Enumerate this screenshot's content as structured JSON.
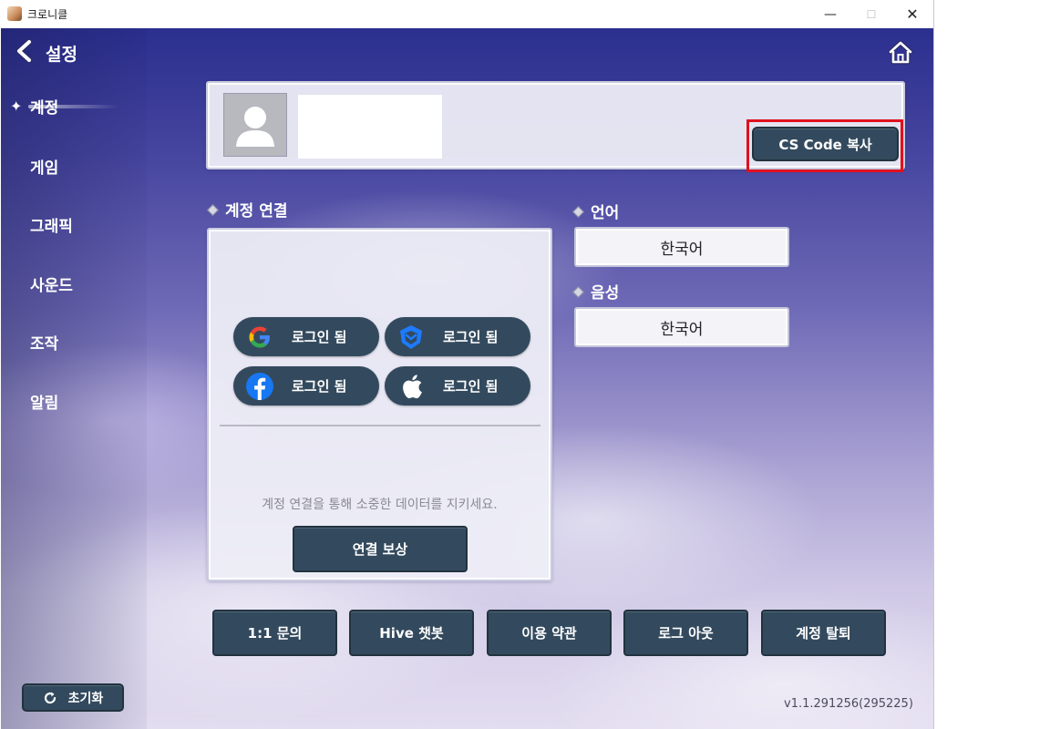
{
  "window": {
    "title": "크로니클",
    "minimize": "—",
    "maximize": "☐",
    "close": "✕"
  },
  "header": {
    "title": "설정"
  },
  "sidebar": {
    "items": [
      {
        "label": "계정",
        "active": true
      },
      {
        "label": "게임"
      },
      {
        "label": "그래픽"
      },
      {
        "label": "사운드"
      },
      {
        "label": "조작"
      },
      {
        "label": "알림"
      }
    ]
  },
  "profile": {
    "cs_button": "CS Code 복사"
  },
  "account_link": {
    "title": "계정 연결",
    "logins": [
      {
        "provider_icon": "google-icon",
        "label": "로그인 됨"
      },
      {
        "provider_icon": "hive-icon",
        "label": "로그인 됨"
      },
      {
        "provider_icon": "facebook-icon",
        "label": "로그인 됨"
      },
      {
        "provider_icon": "apple-icon",
        "label": "로그인 됨"
      }
    ],
    "hint": "계정 연결을 통해 소중한 데이터를 지키세요.",
    "reward_button": "연결 보상"
  },
  "language": {
    "title": "언어",
    "value": "한국어"
  },
  "voice": {
    "title": "음성",
    "value": "한국어"
  },
  "bottom_buttons": [
    "1:1 문의",
    "Hive 챗봇",
    "이용 약관",
    "로그 아웃",
    "계정 탈퇴"
  ],
  "reset_button": "초기화",
  "version": "v1.1.291256(295225)",
  "colors": {
    "button_dark": "#334a5e",
    "highlight": "#e0101e"
  }
}
